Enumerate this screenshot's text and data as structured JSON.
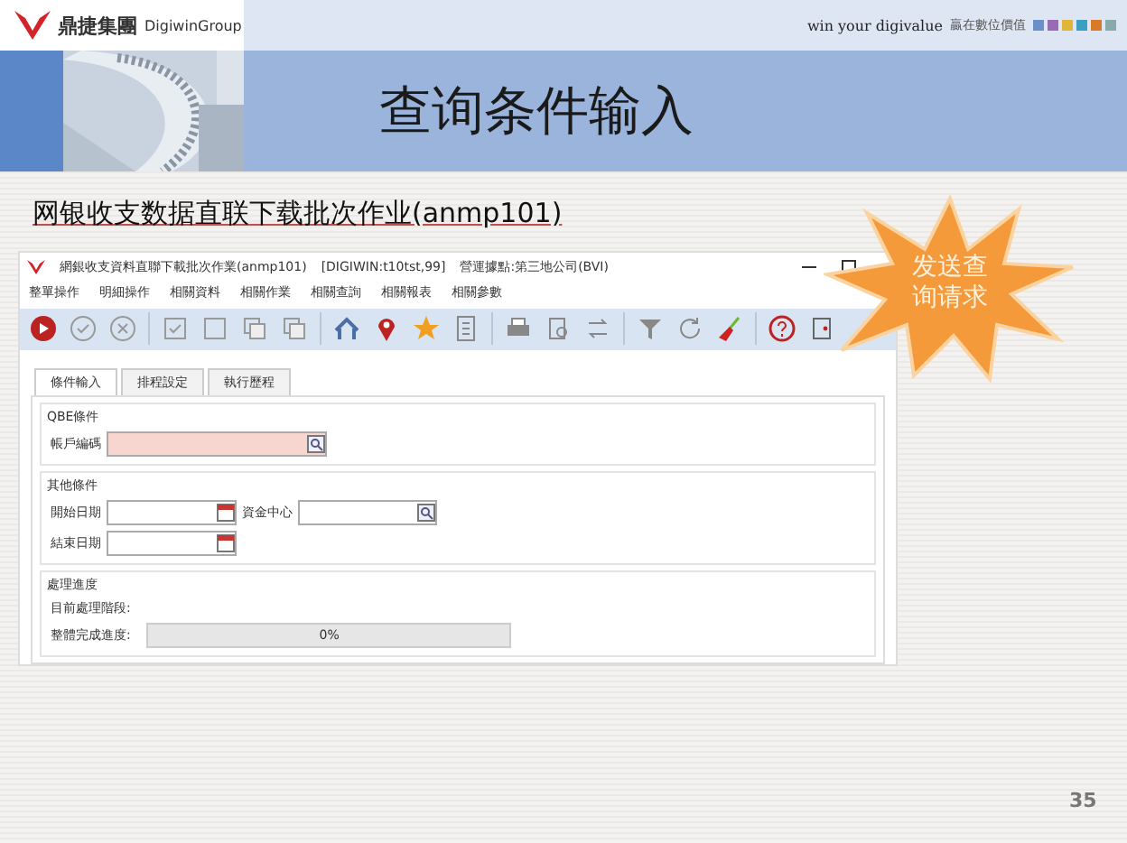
{
  "header": {
    "brand_cn": "鼎捷集團",
    "brand_en": "DigiwinGroup",
    "slogan_en": "win your digivalue",
    "slogan_cn": "贏在數位價值",
    "title": "查询条件输入"
  },
  "subtitle": "网银收支数据直联下载批次作业(anmp101)",
  "callout": "发送查询请求",
  "app": {
    "title": "網銀收支資料直聯下載批次作業(anmp101)",
    "env": "[DIGIWIN:t10tst,99]",
    "site": "營運據點:第三地公司(BVI)",
    "menu": [
      "整單操作",
      "明細操作",
      "相關資料",
      "相關作業",
      "相關查詢",
      "相關報表",
      "相關參數"
    ],
    "tabs": [
      {
        "label": "條件輸入",
        "selected": true
      },
      {
        "label": "排程設定",
        "selected": false
      },
      {
        "label": "執行歷程",
        "selected": false
      }
    ],
    "groups": [
      {
        "title": "QBE條件",
        "fields": [
          {
            "label": "帳戶編碼",
            "kind": "lookup",
            "required": true
          }
        ]
      },
      {
        "title": "其他條件",
        "fields": [
          {
            "label": "開始日期",
            "kind": "date",
            "required": false
          },
          {
            "label": "資金中心",
            "kind": "lookup",
            "required": false
          },
          {
            "label": "結束日期",
            "kind": "date",
            "required": false
          }
        ]
      },
      {
        "title": "處理進度",
        "stage_label": "目前處理階段:",
        "progress_label": "整體完成進度:",
        "progress": {
          "level": 0,
          "reading": "0%"
        }
      }
    ]
  },
  "page_number": "35"
}
